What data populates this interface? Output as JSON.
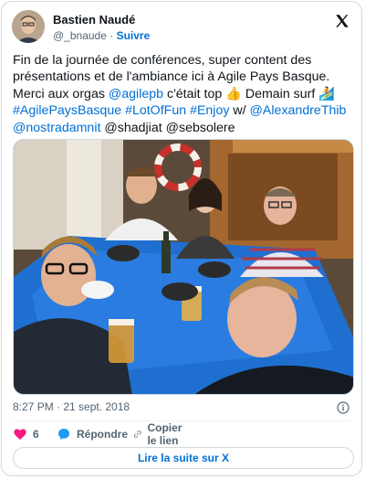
{
  "author": {
    "display_name": "Bastien Naudé",
    "handle": "@_bnaude",
    "separator": "·",
    "follow_label": "Suivre"
  },
  "tweet": {
    "line1": "Fin de la journée de conférences, super content des",
    "line2": "présentations et de l'ambiance ici à Agile Pays Basque.",
    "line3_a": "Merci aux orgas ",
    "mention_agilepb": "@agilepb",
    "line3_b": " c'était top ",
    "line3_emoji1": "👍",
    "line3_c": " Demain surf ",
    "line3_emoji2": "🏄",
    "tag1": "#AgilePaysBasque",
    "tag2": "#LotOfFun",
    "tag3": "#Enjoy",
    "line4_w": " w/ ",
    "mention_alex": "@AlexandreThib",
    "mention_nostra": "@nostradamnit",
    "line5_rest": " @shadjiat @sebsolere"
  },
  "meta": {
    "timestamp": "8:27 PM · 21 sept. 2018"
  },
  "actions": {
    "like_count": "6",
    "reply_label": "Répondre",
    "copy_label": "Copier le lien"
  },
  "readmore_label": "Lire la suite sur X",
  "colors": {
    "link": "#006fd6",
    "like": "#f91880",
    "muted": "#536471",
    "table": "#1f6fd0"
  },
  "icons": {
    "x_logo": "x-logo-icon",
    "info": "info-icon",
    "like": "heart-icon",
    "reply": "reply-bubble-icon",
    "copy": "link-icon"
  }
}
